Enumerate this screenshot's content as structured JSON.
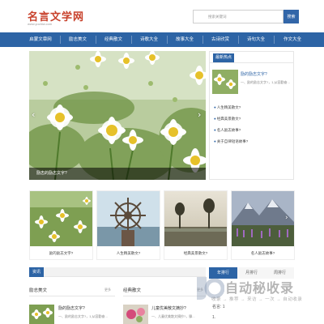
{
  "site": {
    "logo": "名言文学网",
    "logo_tail": "网",
    "logo_sub": "www.yuchiw.com"
  },
  "search": {
    "placeholder": "搜索关键词",
    "button": "搜索"
  },
  "nav": [
    "启蒙文章网",
    "励志美文",
    "经典散文",
    "诗歌大全",
    "故事大全",
    "古诗欣赏",
    "诗句大全",
    "作文大全"
  ],
  "slider": {
    "caption": "励志的励志文字?",
    "prev": "‹",
    "next": "›"
  },
  "hot": {
    "title": "最新热点",
    "featured_title": "励的励志文字?",
    "featured_desc": "一、励的励志文字?，1,从容勤奋...",
    "items": [
      "人生精美散文?",
      "经典美景散文?",
      "名人励志故事?",
      "关于自律短语故事?"
    ]
  },
  "thumbs": [
    {
      "caption": "励的励志文字?"
    },
    {
      "caption": "人生精美散文?"
    },
    {
      "caption": "经典美景散文?"
    },
    {
      "caption": "名人励志故事?"
    }
  ],
  "info_tag": "资讯",
  "sections": {
    "left": {
      "title": "励志美文",
      "more": "更多"
    },
    "right": {
      "title": "经典散文",
      "more": "更多"
    }
  },
  "items": {
    "left": {
      "title": "励的励志文字?",
      "desc": "一、励的励志文字?，1,从容勤奋..."
    },
    "right": {
      "title": "儿童优美散文摘抄?",
      "desc": "一、儿童优美散文摘抄?，臊..."
    }
  },
  "rtabs": [
    "年排行",
    "月排行",
    "周排行"
  ],
  "rlist": [
    "名言: 1",
    "1."
  ],
  "watermark": {
    "title": "自动秘收录",
    "sub": "收录 → 推荐 → 来访 → 一次 → 自动收录"
  },
  "colors": {
    "brand": "#2d64a5",
    "logo": "#c8412b"
  }
}
